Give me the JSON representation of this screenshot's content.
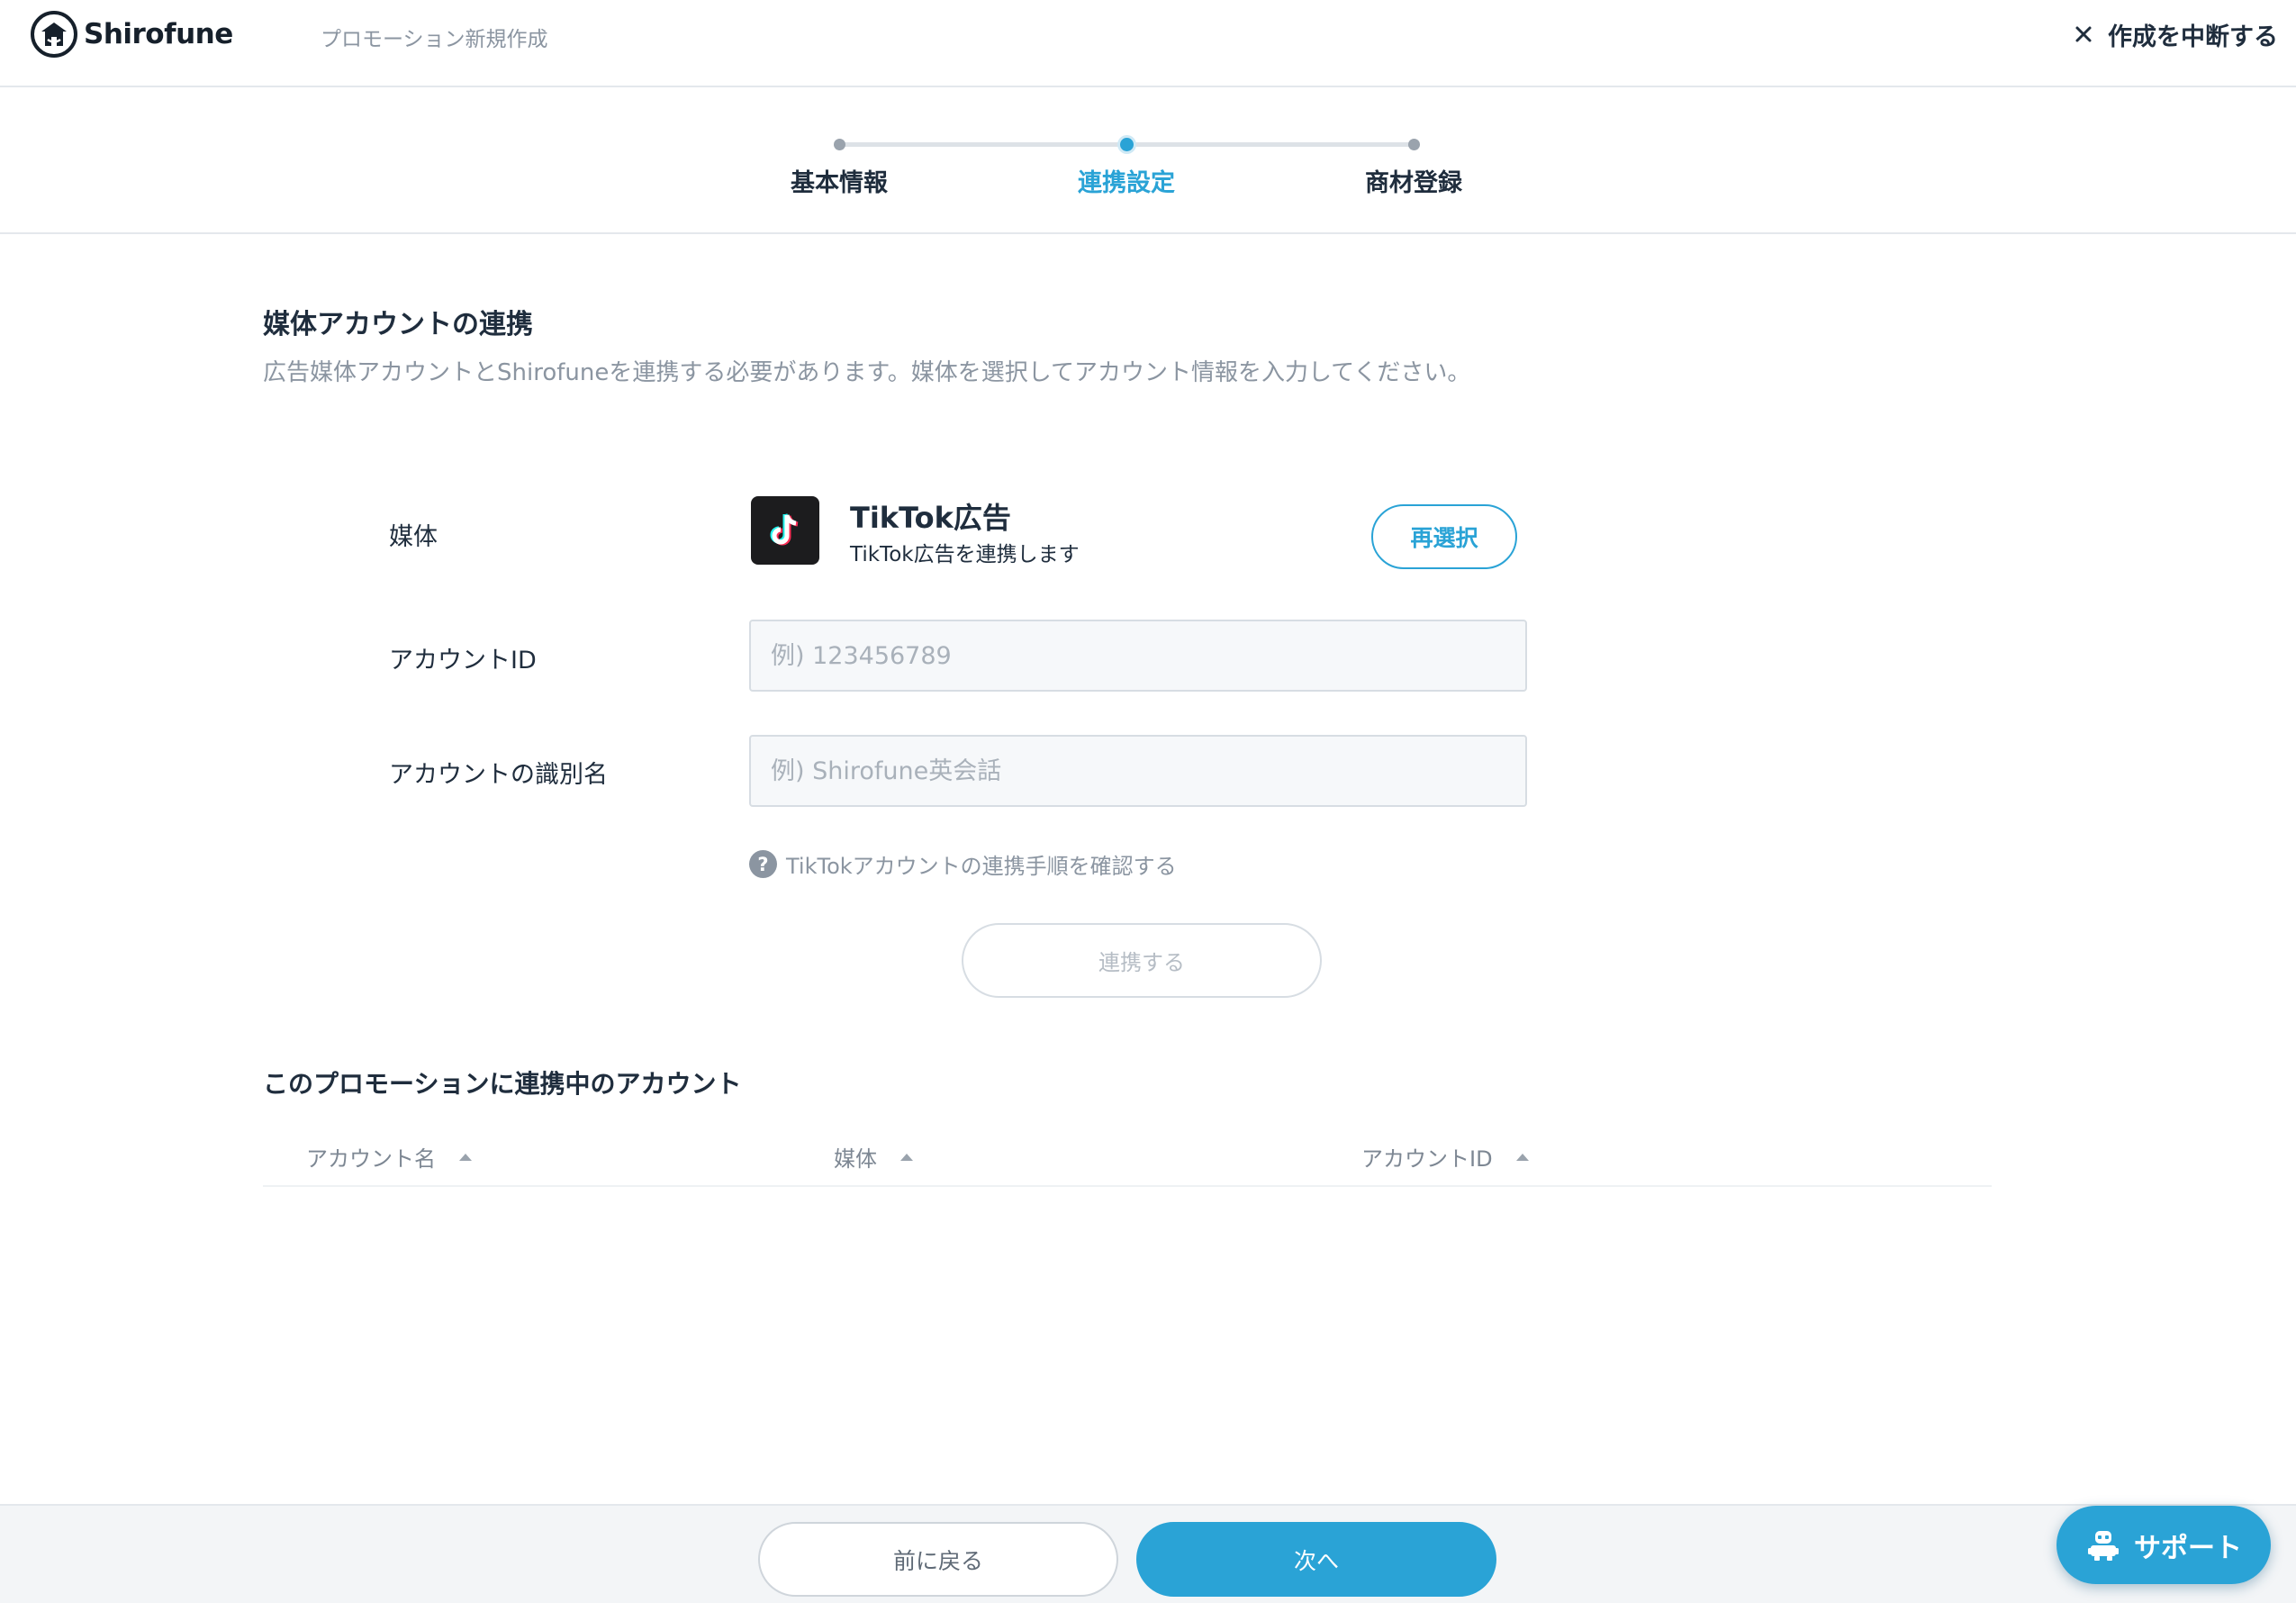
{
  "header": {
    "logo_text": "Shirofune",
    "page_name": "プロモーション新規作成",
    "abort_label": "作成を中断する"
  },
  "stepper": {
    "steps": [
      {
        "label": "基本情報",
        "active": false
      },
      {
        "label": "連携設定",
        "active": true
      },
      {
        "label": "商材登録",
        "active": false
      }
    ]
  },
  "section": {
    "title": "媒体アカウントの連携",
    "description": "広告媒体アカウントとShirofuneを連携する必要があります。媒体を選択してアカウント情報を入力してください。"
  },
  "form": {
    "media_label": "媒体",
    "media": {
      "icon": "tiktok-icon",
      "name": "TikTok広告",
      "subtitle": "TikTok広告を連携します"
    },
    "reselect_label": "再選択",
    "account_id_label": "アカウントID",
    "account_id_value": "",
    "account_id_placeholder": "例) 123456789",
    "account_name_label": "アカウントの識別名",
    "account_name_value": "",
    "account_name_placeholder": "例) Shirofune英会話",
    "help_link": "TikTokアカウントの連携手順を確認する",
    "link_button": "連携する"
  },
  "linked_accounts": {
    "title": "このプロモーションに連携中のアカウント",
    "columns": [
      "アカウント名",
      "媒体",
      "アカウントID"
    ],
    "rows": []
  },
  "footer": {
    "back_label": "前に戻る",
    "next_label": "次へ"
  },
  "support": {
    "label": "サポート"
  },
  "colors": {
    "accent": "#2aa3d6",
    "text": "#1f2d3d",
    "muted": "#8b95a1",
    "border": "#d7dde3"
  }
}
